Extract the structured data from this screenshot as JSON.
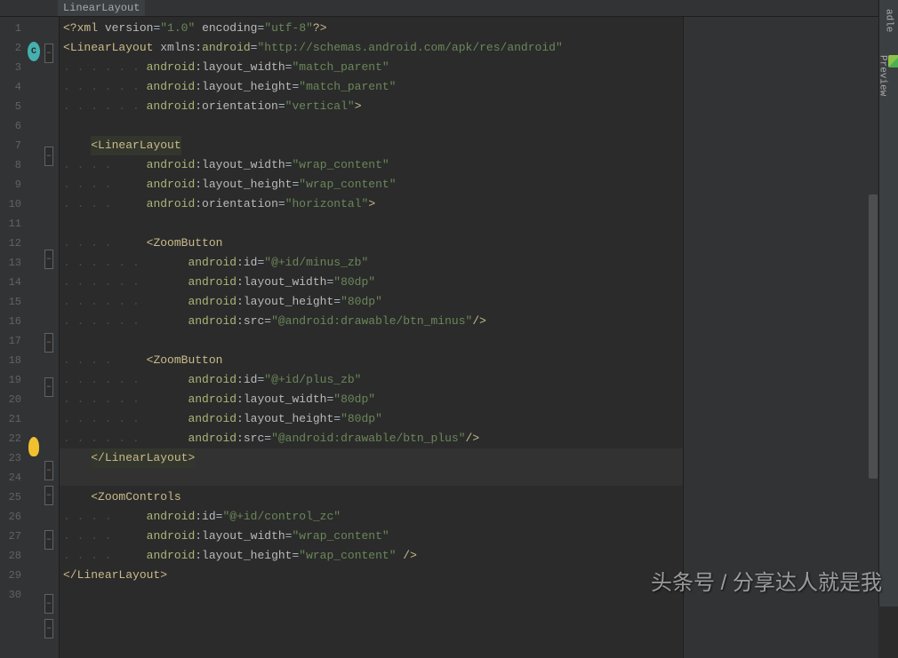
{
  "breadcrumb": {
    "root": "LinearLayout"
  },
  "rightTabs": {
    "gradle": "adle",
    "preview": "Preview"
  },
  "watermark": "头条号 / 分享达人就是我",
  "lineCount": 30,
  "code": {
    "l1": {
      "p1": "<?",
      "t": "xml",
      "a1": "version",
      "v1": "\"1.0\"",
      "a2": "encoding",
      "v2": "\"utf-8\"",
      "p2": "?>"
    },
    "l2": {
      "p": "<",
      "t": "LinearLayout",
      "ns": "xmlns:",
      "a": "android",
      "v": "\"http://schemas.android.com/apk/res/android\""
    },
    "l3": {
      "ns": "android",
      "a": ":layout_width",
      "v": "\"match_parent\""
    },
    "l4": {
      "ns": "android",
      "a": ":layout_height",
      "v": "\"match_parent\""
    },
    "l5": {
      "ns": "android",
      "a": ":orientation",
      "v": "\"vertical\"",
      "p": ">"
    },
    "l7": {
      "p": "<",
      "t": "LinearLayout"
    },
    "l8": {
      "ns": "android",
      "a": ":layout_width",
      "v": "\"wrap_content\""
    },
    "l9": {
      "ns": "android",
      "a": ":layout_height",
      "v": "\"wrap_content\""
    },
    "l10": {
      "ns": "android",
      "a": ":orientation",
      "v": "\"horizontal\"",
      "p": ">"
    },
    "l12": {
      "p": "<",
      "t": "ZoomButton"
    },
    "l13": {
      "ns": "android",
      "a": ":id",
      "v": "\"@+id/minus_zb\""
    },
    "l14": {
      "ns": "android",
      "a": ":layout_width",
      "v": "\"80dp\""
    },
    "l15": {
      "ns": "android",
      "a": ":layout_height",
      "v": "\"80dp\""
    },
    "l16": {
      "ns": "android",
      "a": ":src",
      "v": "\"@android:drawable/btn_minus\"",
      "p": "/>"
    },
    "l18": {
      "p": "<",
      "t": "ZoomButton"
    },
    "l19": {
      "ns": "android",
      "a": ":id",
      "v": "\"@+id/plus_zb\""
    },
    "l20": {
      "ns": "android",
      "a": ":layout_width",
      "v": "\"80dp\""
    },
    "l21": {
      "ns": "android",
      "a": ":layout_height",
      "v": "\"80dp\""
    },
    "l22": {
      "ns": "android",
      "a": ":src",
      "v": "\"@android:drawable/btn_plus\"",
      "p": "/>"
    },
    "l23": {
      "p1": "</",
      "t": "LinearLayout",
      "p2": ">"
    },
    "l25": {
      "p": "<",
      "t": "ZoomControls"
    },
    "l26": {
      "ns": "android",
      "a": ":id",
      "v": "\"@+id/control_zc\""
    },
    "l27": {
      "ns": "android",
      "a": ":layout_width",
      "v": "\"wrap_content\""
    },
    "l28": {
      "ns": "android",
      "a": ":layout_height",
      "v": "\"wrap_content\"",
      "p": " />"
    },
    "l29": {
      "p1": "</",
      "t": "LinearLayout",
      "p2": ">"
    }
  },
  "dots": {
    "d4": ". . . . ",
    "d6": ". . . . . . ",
    "d8": ". . . . . . . . ",
    "d10": ". . . . . . . . . . "
  }
}
